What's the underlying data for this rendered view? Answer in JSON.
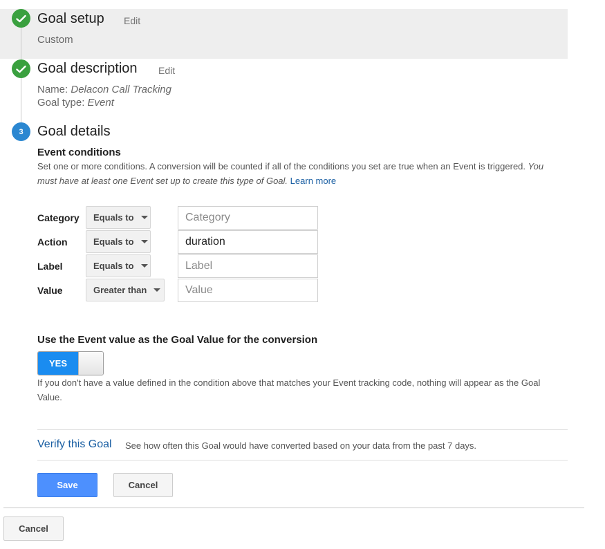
{
  "step1": {
    "title": "Goal setup",
    "edit_label": "Edit",
    "value": "Custom"
  },
  "step2": {
    "title": "Goal description",
    "edit_label": "Edit",
    "name_label": "Name:",
    "name_value": "Delacon Call Tracking",
    "type_label": "Goal type:",
    "type_value": "Event"
  },
  "step3": {
    "number": "3",
    "title": "Goal details",
    "conditions_heading": "Event conditions",
    "help_text": "Set one or more conditions. A conversion will be counted if all of the conditions you set are true when an Event is triggered.",
    "help_italic": "You must have at least one Event set up to create this type of Goal.",
    "learn_more": "Learn more",
    "conditions": [
      {
        "label": "Category",
        "operator": "Equals to",
        "value": "",
        "placeholder": "Category"
      },
      {
        "label": "Action",
        "operator": "Equals to",
        "value": "duration",
        "placeholder": ""
      },
      {
        "label": "Label",
        "operator": "Equals to",
        "value": "",
        "placeholder": "Label"
      },
      {
        "label": "Value",
        "operator": "Greater than",
        "value": "",
        "placeholder": "Value"
      }
    ],
    "goal_value_heading": "Use the Event value as the Goal Value for the conversion",
    "toggle_label": "YES",
    "toggle_state": "on",
    "goal_value_note": "If you don't have a value defined in the condition above that matches your Event tracking code, nothing will appear as the Goal Value.",
    "verify_label": "Verify this Goal",
    "verify_desc": "See how often this Goal would have converted based on your data from the past 7 days.",
    "save_label": "Save",
    "cancel_label": "Cancel"
  },
  "footer": {
    "cancel_label": "Cancel"
  },
  "colors": {
    "check_green": "#3aa03f",
    "step_blue": "#2b87d1",
    "primary_button": "#4d90fe",
    "toggle_on": "#1a8cf0",
    "link": "#1a5fa3"
  }
}
